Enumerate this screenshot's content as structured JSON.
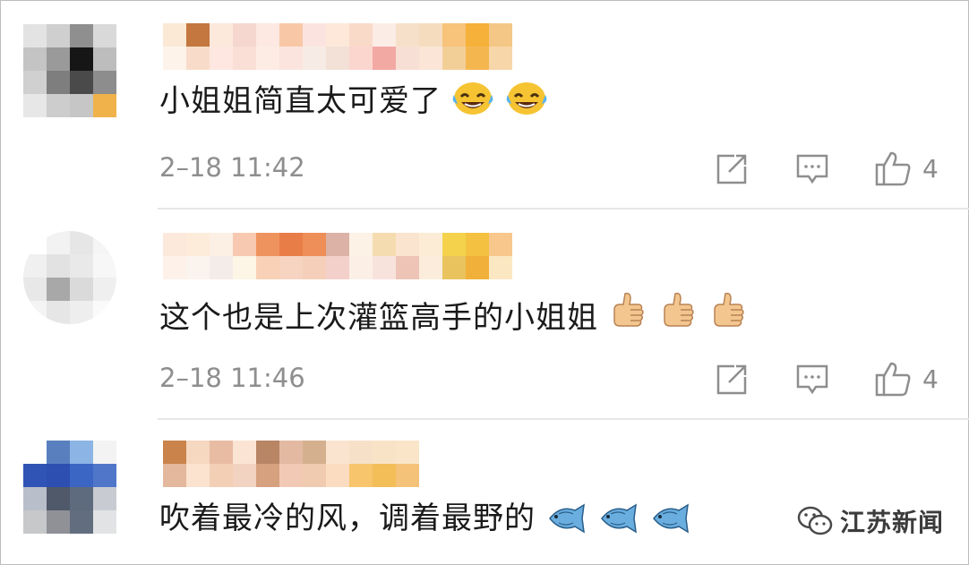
{
  "comments": [
    {
      "text": "小姐姐简直太可爱了",
      "emojis": [
        "laughing-tears-emoji",
        "laughing-tears-emoji"
      ],
      "time": "2–18 11:42",
      "likes": "4",
      "avatar_colors": [
        "#e3e3e3",
        "#cfcfcf",
        "#8f8f8f",
        "#d9d9d9",
        "#c4c4c4",
        "#9a9a9a",
        "#161616",
        "#bdbdbd",
        "#d0d0d0",
        "#7e7e7e",
        "#4a4a4a",
        "#8d8d8d",
        "#e7e7e7",
        "#cdcdcd",
        "#c6c6c6",
        "#f0b24a"
      ],
      "username_colors": [
        [
          "#fbe9d6",
          "#c4773e",
          "#fde9dc",
          "#f5d7cf",
          "#fde8e2",
          "#f8c8a6",
          "#fbe4e0",
          "#fde8d9",
          "#f9dac9",
          "#fcece6",
          "#f7e0c9",
          "#f6dcbf",
          "#f8c37a",
          "#f5b13a",
          "#f4c786"
        ],
        [
          "#fdf3ea",
          "#f8dcc9",
          "#fde7e0",
          "#f9dfd6",
          "#fdece4",
          "#fbe4dd",
          "#f7ece5",
          "#f3e0d6",
          "#fbd6cf",
          "#f2a9a4",
          "#f8dfd5",
          "#fae5d6",
          "#f3cf98",
          "#f4b750",
          "#f7d6a9"
        ]
      ]
    },
    {
      "text": "这个也是上次灌篮高手的小姐姐",
      "emojis": [
        "thumbs-up-emoji",
        "thumbs-up-emoji",
        "thumbs-up-emoji"
      ],
      "time": "2–18 11:46",
      "likes": "4",
      "avatar_colors": [
        "#ffffff",
        "#f2f2f2",
        "#e6e6e6",
        "#f5f5f5",
        "#f0f0f0",
        "#e2e2e2",
        "#e9e9e9",
        "#f7f7f7",
        "#e8e8e8",
        "#a8a8a8",
        "#dadada",
        "#efefef",
        "#f4f4f4",
        "#e6e6e6",
        "#eeeeee",
        "#fafafa"
      ],
      "username_colors": [
        [
          "#fce9dc",
          "#fcecd9",
          "#fcefe4",
          "#f7c9b0",
          "#ef935e",
          "#e97d48",
          "#ee8e58",
          "#dcb2a7",
          "#fdf2e6",
          "#f5dcb0",
          "#fbe4cf",
          "#fcecd6",
          "#f4d24c",
          "#f4c240",
          "#f7c78c"
        ],
        [
          "#fdf1e9",
          "#fbf3ee",
          "#f4ece9",
          "#fdf5e6",
          "#f8d1b6",
          "#f7d3c2",
          "#f5cfb9",
          "#f4d0cb",
          "#fcefe6",
          "#f8e3dc",
          "#edc4b6",
          "#fbecdc",
          "#e9c35d",
          "#f1b03a",
          "#fbe7c2"
        ]
      ]
    },
    {
      "text": "吹着最冷的风，调着最野的",
      "emojis": [
        "fish-emoji",
        "fish-emoji",
        "fish-emoji"
      ],
      "time": "",
      "likes": "",
      "avatar_colors": [
        "#ffffff",
        "#5a7fbf",
        "#8cb4e5",
        "#f3f3f3",
        "#3054b6",
        "#2c4fb1",
        "#3c66c4",
        "#4f76c9",
        "#b9bfca",
        "#4f5969",
        "#5e6a7d",
        "#c8ccd2",
        "#c7c8ca",
        "#8f9197",
        "#626d7f",
        "#e2e3e5"
      ],
      "username_colors": [
        [
          "#c9834b",
          "#f6d7bf",
          "#e8bca3",
          "#fbe4d4",
          "#b88565",
          "#e3b9a2",
          "#d5b08f",
          "#fae4cf",
          "#f6e1c8",
          "#f9e3c6",
          "#fae5c8"
        ],
        [
          "#e4b89c",
          "#fbe3cf",
          "#f3cfb6",
          "#f2d2c0",
          "#d6a17f",
          "#f2c9b5",
          "#f0cbb0",
          "#fbdcc0",
          "#f7c56b",
          "#f3be58",
          "#f5c27a"
        ]
      ]
    }
  ],
  "watermark": {
    "text": "江苏新闻"
  },
  "icons": {
    "share": "share-icon",
    "reply": "comment-icon",
    "like": "thumbs-up-icon"
  }
}
